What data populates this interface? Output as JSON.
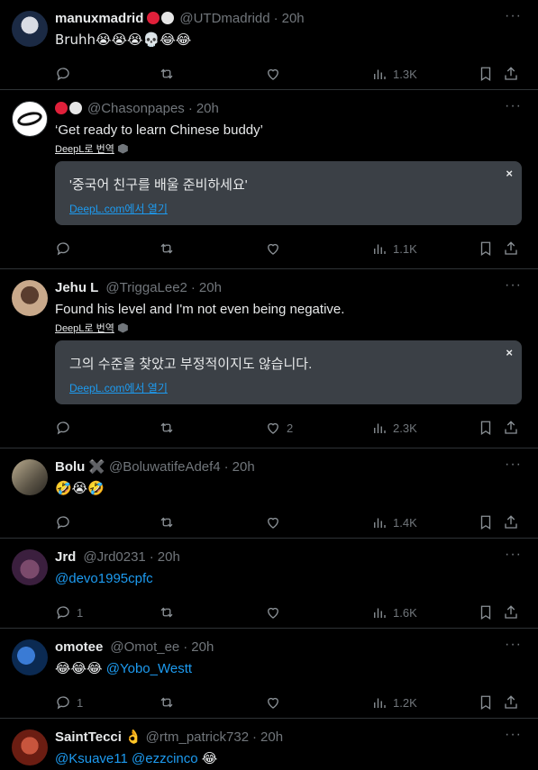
{
  "tweets": [
    {
      "name": "manuxmadrid",
      "badges": [
        "red",
        "white"
      ],
      "handle": "@UTDmadridd",
      "time": "20h",
      "text": "Bruhh😭😭😭💀😂😂",
      "reply_count": "",
      "like_count": "",
      "views": "1.3K",
      "avatar_colors": [
        "#1b2a44",
        "#d9dce4"
      ]
    },
    {
      "name": "",
      "badges": [
        "red",
        "white"
      ],
      "handle": "@Chasonpapes",
      "time": "20h",
      "text": "‘Get ready to learn Chinese buddy’",
      "translate_label": "DeepL로 번역",
      "translation": "'중국어 친구를 배울 준비하세요'",
      "translation_link": "DeepL.com에서 열기",
      "close": "×",
      "reply_count": "",
      "like_count": "",
      "views": "1.1K",
      "avatar_colors": [
        "#ffffff",
        "#1a1a1a"
      ]
    },
    {
      "name": "Jehu L",
      "handle": "@TriggaLee2",
      "time": "20h",
      "text": "Found his level and I'm not even being negative.",
      "translate_label": "DeepL로 번역",
      "translation": "그의 수준을 찾았고 부정적이지도 않습니다.",
      "translation_link": "DeepL.com에서 열기",
      "close": "×",
      "reply_count": "",
      "like_count": "2",
      "views": "2.3K",
      "avatar_colors": [
        "#5a3d2e",
        "#c9a98b"
      ]
    },
    {
      "name": "Bolu",
      "name_suffix": "✖️",
      "handle": "@BoluwatifeAdef4",
      "time": "20h",
      "text": "🤣😭🤣",
      "reply_count": "",
      "like_count": "",
      "views": "1.4K",
      "avatar_colors": [
        "#5b5446",
        "#b9ab8e"
      ]
    },
    {
      "name": "Jrd",
      "handle": "@Jrd0231",
      "time": "20h",
      "mention": "@devo1995cpfc",
      "reply_count": "1",
      "like_count": "",
      "views": "1.6K",
      "avatar_colors": [
        "#3b1f3e",
        "#7b4a6c"
      ]
    },
    {
      "name": "omotee",
      "handle": "@Omot_ee",
      "time": "20h",
      "text": "😂😂😂",
      "mention": "@Yobo_Westt",
      "reply_count": "1",
      "like_count": "",
      "views": "1.2K",
      "avatar_colors": [
        "#0b2a52",
        "#3a7bd5"
      ]
    },
    {
      "name": "SaintTecci",
      "name_suffix": "👌",
      "handle": "@rtm_patrick732",
      "time": "20h",
      "mention": "@Ksuave11 @ezzcinco",
      "text": "😂",
      "avatar_colors": [
        "#6b1d12",
        "#c8553d"
      ]
    }
  ],
  "icons": [
    "reply-icon",
    "retweet-icon",
    "like-icon",
    "views-icon",
    "bookmark-icon",
    "share-icon",
    "more-icon",
    "close-icon"
  ],
  "colors": {
    "accent": "#1d9bf0",
    "muted": "#71767b",
    "text": "#e7e9ea",
    "border": "#2f3336",
    "translation_bg": "#3b4046"
  }
}
